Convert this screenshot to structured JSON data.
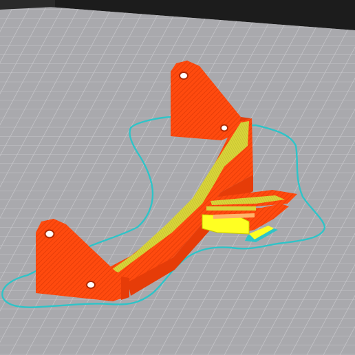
{
  "viewer": {
    "background_color": "#1c1c1c",
    "bed_color": "#a9a9ad",
    "grid_color": "#c7c7cb",
    "outer_wall_color": "#ff4a0e",
    "outer_wall_dark_color": "#e63c08",
    "infill_color": "#d8d43a",
    "support_color": "#ffff22",
    "skirt_color": "#2ec4c8",
    "icons": {
      "bed": "build-plate-icon",
      "model": "sliced-bracket-icon",
      "skirt": "skirt-outline-icon"
    }
  }
}
